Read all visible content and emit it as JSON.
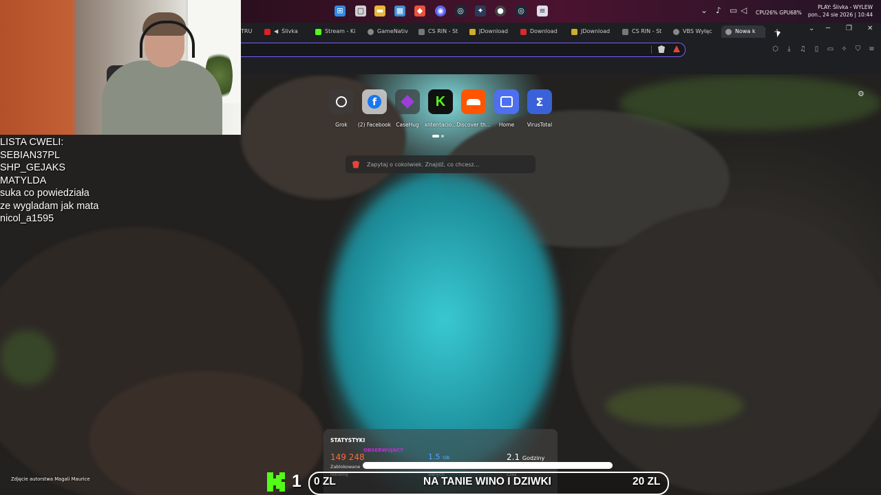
{
  "taskbar": {
    "tray": {
      "cpu_gpu": "CPU26% GPU68%",
      "now_playing": "PLAY: Ślivka - WYLEW",
      "datetime": "pon., 24 sie 2026 | 10:44"
    }
  },
  "tabs": [
    {
      "label": "TRU"
    },
    {
      "label": "Ślivka"
    },
    {
      "label": "Stream - Ki"
    },
    {
      "label": "GameNativ"
    },
    {
      "label": "CS RIN - St"
    },
    {
      "label": "JDownload"
    },
    {
      "label": "Download"
    },
    {
      "label": "JDownload"
    },
    {
      "label": "CS RIN - St"
    },
    {
      "label": "VBS Wyłąc"
    },
    {
      "label": "Nowa k",
      "active": true
    }
  ],
  "shortcuts": [
    {
      "label": "Grok"
    },
    {
      "label": "(2) Facebook"
    },
    {
      "label": "CaseHug"
    },
    {
      "label": "xntentacio..."
    },
    {
      "label": "Discover th..."
    },
    {
      "label": "Home"
    },
    {
      "label": "VirusTotal"
    }
  ],
  "search": {
    "placeholder": "Zapytaj o cokolwiek. Znajdź, co chcesz..."
  },
  "overlay": {
    "lines": [
      "LISTA CWELI:",
      "SEBIAN37PL",
      "SHP_GEJAKS",
      "MATYLDA",
      "suka co powiedziała",
      "ze wygladam jak mata",
      "nicol_a1595"
    ]
  },
  "stats": {
    "title": "STATYSTYKI",
    "blocked_value": "149 248",
    "blocked_label": "Zablokowane",
    "blocked_sub": "reklamy",
    "data_value": "1.5",
    "data_unit": "GB",
    "data_sub": "danych",
    "time_value": "2.1",
    "time_unit": "Godziny",
    "time_sub": "czas",
    "overlay_purple": "OBSERWUJĄCY"
  },
  "photo_credit": "Zdjęcie autorstwa Magali Maurice",
  "donation": {
    "kick_count": "1",
    "current": "0 ZL",
    "goal_text": "NA TANIE WINO I DZIWKI",
    "target": "20 ZL",
    "progress_percent": 0
  },
  "colors": {
    "accent": "#7b5cff",
    "kick_green": "#53fc18",
    "stat_orange": "#ff6b3d",
    "stat_blue": "#5aa5ff"
  }
}
